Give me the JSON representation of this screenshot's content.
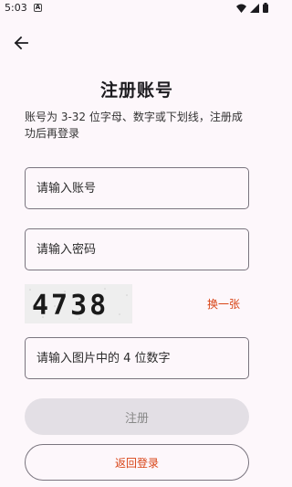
{
  "status": {
    "time": "5:03"
  },
  "title": "注册账号",
  "description": "账号为 3-32 位字母、数字或下划线，注册成功后再登录",
  "account_field": {
    "placeholder": "请输入账号",
    "value": ""
  },
  "password_field": {
    "placeholder": "请输入密码",
    "value": ""
  },
  "captcha": {
    "code": "4738",
    "refresh_label": "换一张"
  },
  "captcha_field": {
    "placeholder": "请输入图片中的 4 位数字",
    "value": ""
  },
  "register_label": "注册",
  "back_to_login_label": "返回登录",
  "colors": {
    "accent": "#d84315",
    "background": "#fdf7fb",
    "disabled_button": "#e3dfe5"
  }
}
